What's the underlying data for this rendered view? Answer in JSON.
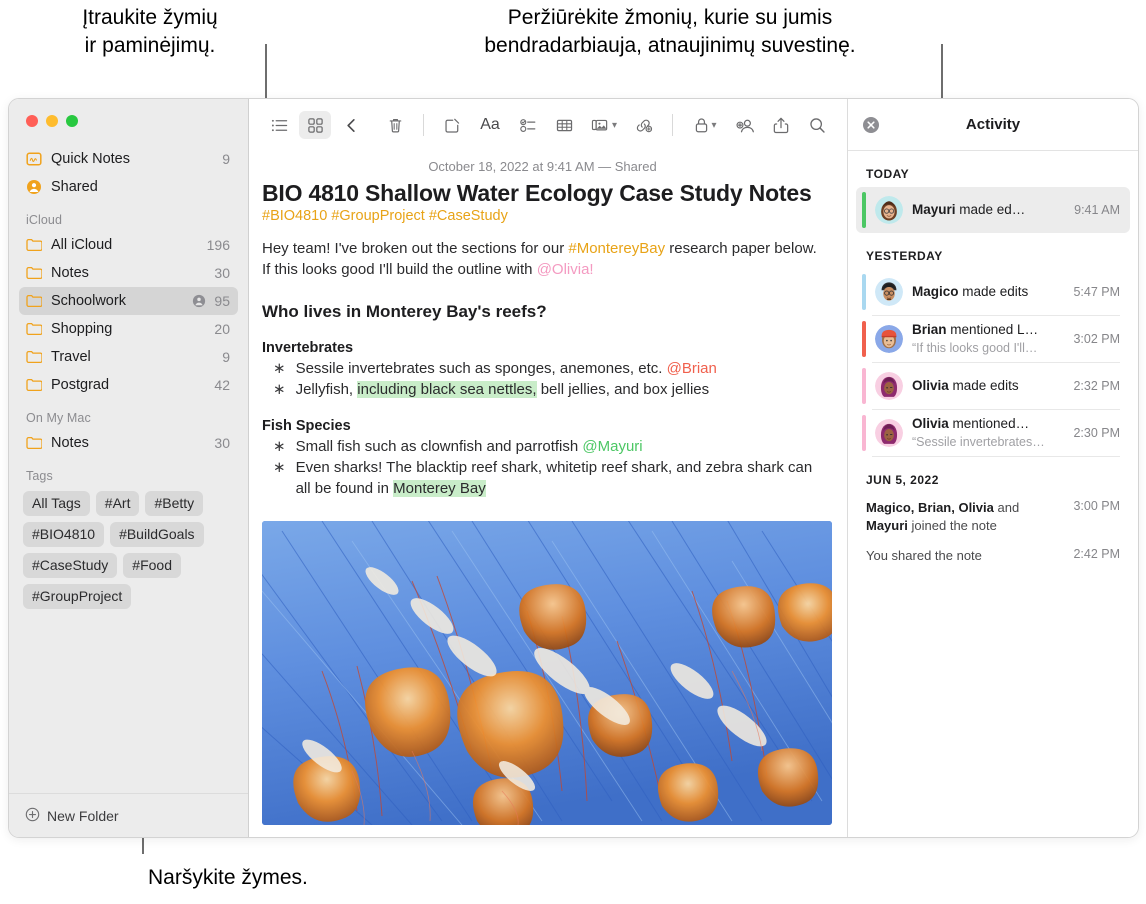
{
  "callouts": {
    "tags": "Įtraukite žymių\nir paminėjimų.",
    "activity": "Peržiūrėkite žmonių, kurie su jumis\nbendradarbiauja, atnaujinimų suvestinę.",
    "browse": "Naršykite žymes."
  },
  "sidebar": {
    "top_items": [
      {
        "label": "Quick Notes",
        "count": "9",
        "icon": "quick-note-icon"
      },
      {
        "label": "Shared",
        "count": "",
        "icon": "shared-person-icon"
      }
    ],
    "sections": [
      {
        "title": "iCloud",
        "items": [
          {
            "label": "All iCloud",
            "count": "196",
            "shared": false
          },
          {
            "label": "Notes",
            "count": "30",
            "shared": false
          },
          {
            "label": "Schoolwork",
            "count": "95",
            "shared": true,
            "selected": true
          },
          {
            "label": "Shopping",
            "count": "20",
            "shared": false
          },
          {
            "label": "Travel",
            "count": "9",
            "shared": false
          },
          {
            "label": "Postgrad",
            "count": "42",
            "shared": false
          }
        ]
      },
      {
        "title": "On My Mac",
        "items": [
          {
            "label": "Notes",
            "count": "30",
            "shared": false
          }
        ]
      }
    ],
    "tags_title": "Tags",
    "tags": [
      "All Tags",
      "#Art",
      "#Betty",
      "#BIO4810",
      "#BuildGoals",
      "#CaseStudy",
      "#Food",
      "#GroupProject"
    ],
    "new_folder_label": "New Folder"
  },
  "toolbar": {
    "list_view": "list-view-icon",
    "gallery_view": "gallery-view-icon",
    "back": "back-chevron-icon",
    "delete": "trash-icon",
    "compose": "compose-icon",
    "format": "Aa",
    "checklist": "checklist-icon",
    "table": "table-icon",
    "media": "media-icon",
    "link": "link-icon",
    "lock": "lock-icon",
    "add_people": "add-person-icon",
    "share": "share-icon",
    "search": "search-icon"
  },
  "note": {
    "date": "October 18, 2022 at 9:41 AM — Shared",
    "title": "BIO 4810 Shallow Water Ecology Case Study Notes",
    "tags_line": "#BIO4810 #GroupProject #CaseStudy",
    "intro_1": "Hey team! I've broken out the sections for our ",
    "intro_hashtag": "#MontereyBay",
    "intro_2": " research paper below. If this looks good I'll build the outline with ",
    "intro_mention": "@Olivia!",
    "heading": "Who lives in Monterey Bay's reefs?",
    "sub1": "Invertebrates",
    "inv_1a": "Sessile invertebrates such as sponges, anemones, etc. ",
    "inv_1_mention": "@Brian",
    "inv_2a": "Jellyfish, ",
    "inv_2_hl": "including black sea nettles,",
    "inv_2b": " bell jellies, and box jellies",
    "sub2": "Fish Species",
    "fish_1a": "Small fish such as clownfish and parrotfish ",
    "fish_1_mention": "@Mayuri",
    "fish_2a": "Even sharks! The blacktip reef shark, whitetip reef shark, and zebra shark can all be found in ",
    "fish_2_hl": "Monterey Bay",
    "photo": "jellyfish-photo"
  },
  "activity": {
    "title": "Activity",
    "close": "close-icon",
    "groups": [
      {
        "label": "TODAY",
        "items": [
          {
            "name": "Mayuri",
            "action": " made ed…",
            "quote": "",
            "time": "9:41 AM",
            "bar": "#4cc764",
            "avatar": "mayuri",
            "selected": true
          }
        ]
      },
      {
        "label": "YESTERDAY",
        "items": [
          {
            "name": "Magico",
            "action": " made edits",
            "quote": "",
            "time": "5:47 PM",
            "bar": "#a9d8f0",
            "avatar": "magico",
            "selected": false
          },
          {
            "name": "Brian",
            "action": " mentioned L…",
            "quote": "“If this looks good I'll…",
            "time": "3:02 PM",
            "bar": "#f0604d",
            "avatar": "brian",
            "selected": false
          },
          {
            "name": "Olivia",
            "action": " made edits",
            "quote": "",
            "time": "2:32 PM",
            "bar": "#f9b6d2",
            "avatar": "olivia",
            "selected": false
          },
          {
            "name": "Olivia",
            "action": " mentioned…",
            "quote": "“Sessile invertebrates…",
            "time": "2:30 PM",
            "bar": "#f9b6d2",
            "avatar": "olivia",
            "selected": false
          }
        ]
      }
    ],
    "old_group_label": "JUN 5, 2022",
    "joined_names": "Magico, Brian, Olivia",
    "joined_mid": " and ",
    "joined_names2": "Mayuri",
    "joined_tail": " joined the note",
    "joined_time": "3:00 PM",
    "shared_text": "You shared the note",
    "shared_time": "2:42 PM"
  }
}
